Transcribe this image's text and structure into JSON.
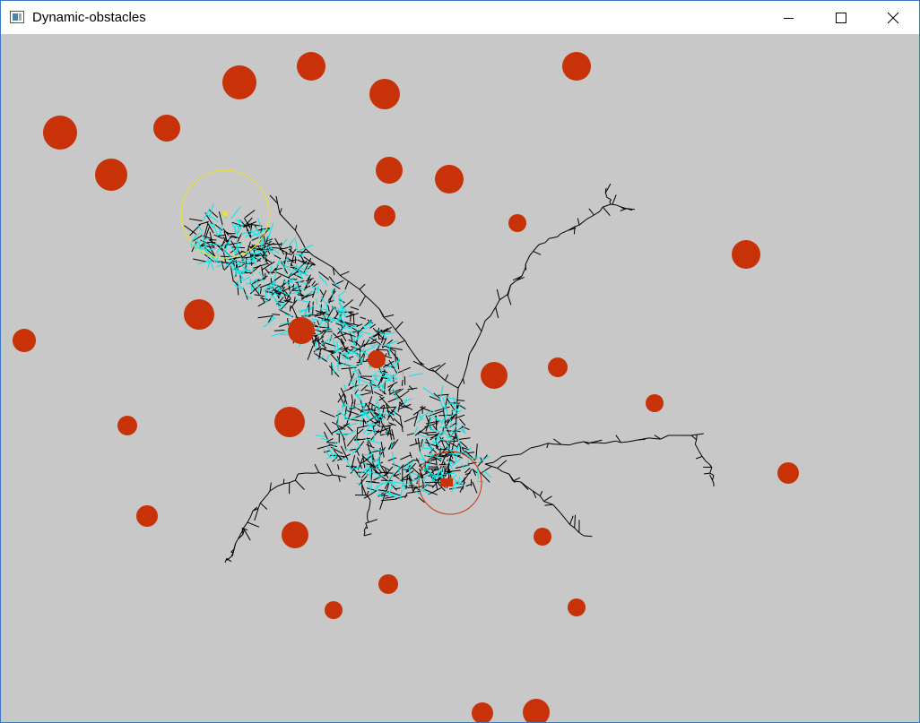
{
  "window": {
    "title": "Dynamic-obstacles",
    "icon": "app-window-icon",
    "controls": [
      "minimize-icon",
      "maximize-icon",
      "close-icon"
    ]
  },
  "colors": {
    "background": "#c8c8c8",
    "obstacle": "#c83208",
    "tree": "#000000",
    "path": "#00e8e8",
    "goal_circle": "#f0e020",
    "start_circle": "#c83208"
  }
}
